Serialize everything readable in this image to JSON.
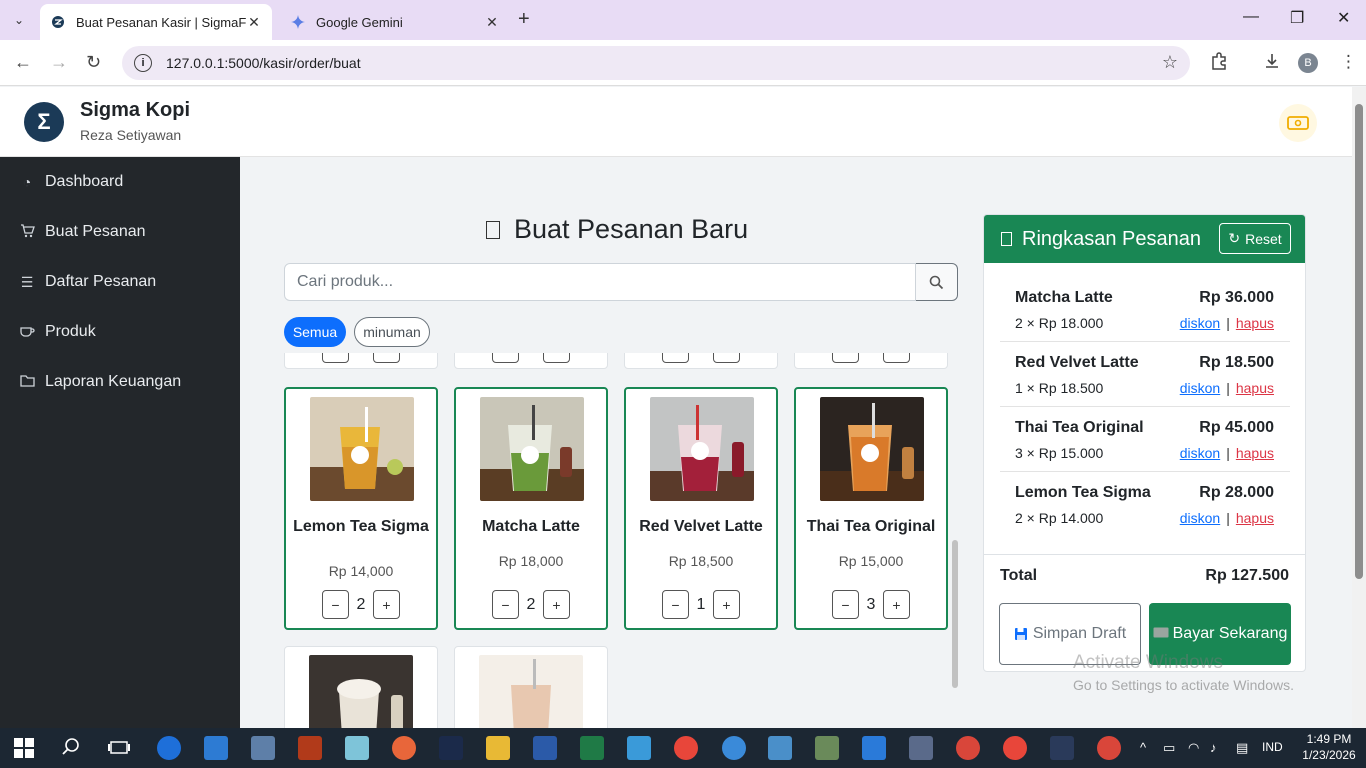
{
  "browser": {
    "tabs": [
      {
        "title": "Buat Pesanan Kasir | SigmaFran",
        "active": true
      },
      {
        "title": "Google Gemini",
        "active": false
      }
    ],
    "url": "127.0.0.1:5000/kasir/order/buat",
    "profile_initial": "B"
  },
  "header": {
    "brand": "Sigma Kopi",
    "user": "Reza Setiyawan"
  },
  "sidebar": {
    "items": [
      {
        "label": "Dashboard",
        "icon": "speedometer-icon"
      },
      {
        "label": "Buat Pesanan",
        "icon": "cart-icon"
      },
      {
        "label": "Daftar Pesanan",
        "icon": "list-icon"
      },
      {
        "label": "Produk",
        "icon": "cup-icon"
      },
      {
        "label": "Laporan Keuangan",
        "icon": "folder-icon"
      }
    ]
  },
  "main": {
    "title": "Buat Pesanan Baru",
    "search_placeholder": "Cari produk...",
    "filters": [
      "Semua",
      "minuman"
    ],
    "products": [
      {
        "name": "Lemon Tea Sigma",
        "price": "Rp 14,000",
        "qty": "2",
        "selected": true
      },
      {
        "name": "Matcha Latte",
        "price": "Rp 18,000",
        "qty": "2",
        "selected": true
      },
      {
        "name": "Red Velvet Latte",
        "price": "Rp 18,500",
        "qty": "1",
        "selected": true
      },
      {
        "name": "Thai Tea Original",
        "price": "Rp 15,000",
        "qty": "3",
        "selected": true
      }
    ]
  },
  "summary": {
    "title": "Ringkasan Pesanan",
    "reset_label": "Reset",
    "items": [
      {
        "name": "Matcha Latte",
        "total": "Rp 36.000",
        "qty_line": "2 × Rp 18.000"
      },
      {
        "name": "Red Velvet Latte",
        "total": "Rp 18.500",
        "qty_line": "1 × Rp 18.500"
      },
      {
        "name": "Thai Tea Original",
        "total": "Rp 45.000",
        "qty_line": "3 × Rp 15.000"
      },
      {
        "name": "Lemon Tea Sigma",
        "total": "Rp 28.000",
        "qty_line": "2 × Rp 14.000"
      }
    ],
    "discount_label": "diskon",
    "delete_label": "hapus",
    "total_label": "Total",
    "total_value": "Rp 127.500",
    "draft_label": "Simpan Draft",
    "pay_label": "Bayar Sekarang"
  },
  "watermark": {
    "line1": "Activate Windows",
    "line2": "Go to Settings to activate Windows."
  },
  "taskbar": {
    "lang": "IND",
    "time": "1:49 PM",
    "date": "1/23/2026"
  },
  "colors": {
    "accent_green": "#198754",
    "primary_blue": "#0d6efd",
    "danger_red": "#dc3545",
    "sidebar_bg": "#23272b"
  }
}
